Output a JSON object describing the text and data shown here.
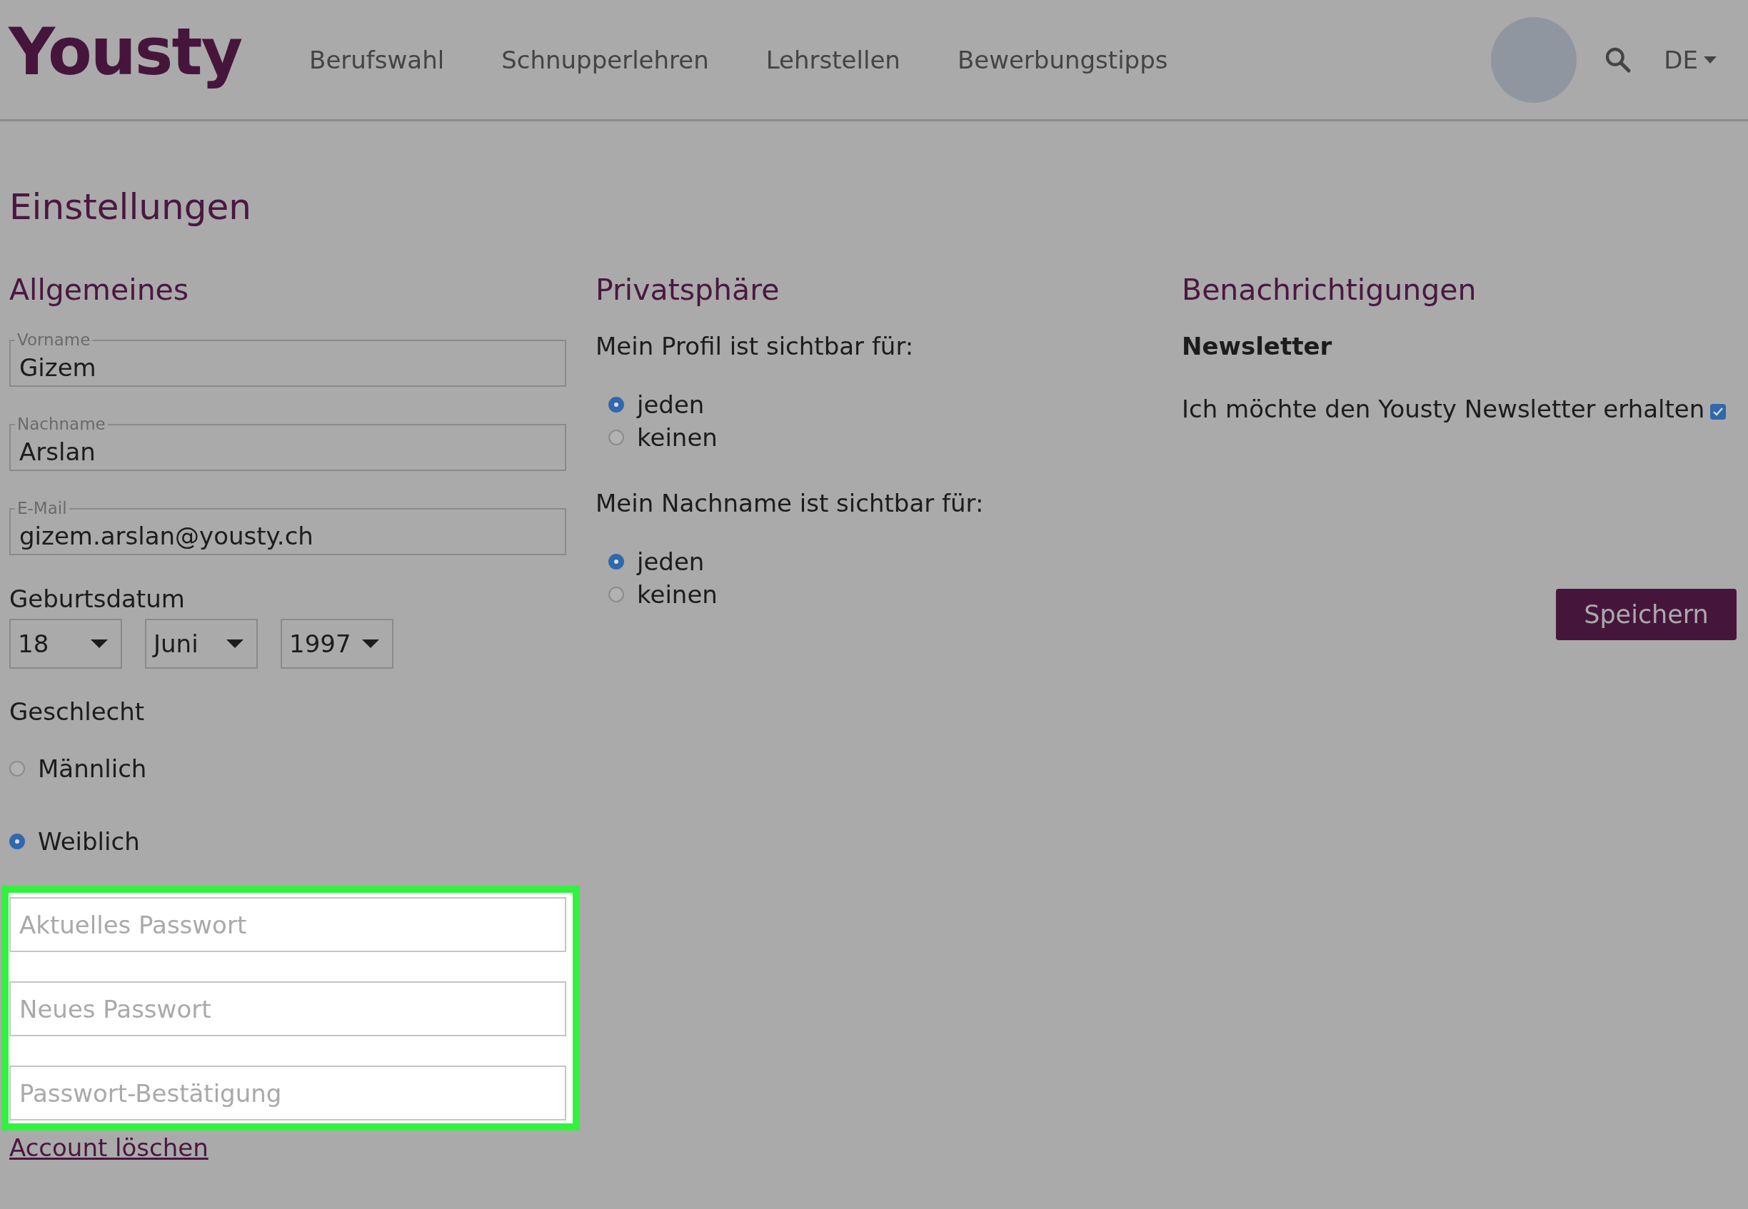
{
  "header": {
    "logo": "Yousty",
    "nav": [
      {
        "label": "Berufswahl"
      },
      {
        "label": "Schnupperlehren"
      },
      {
        "label": "Lehrstellen"
      },
      {
        "label": "Bewerbungstipps"
      }
    ],
    "language": "DE"
  },
  "page_title": "Einstellungen",
  "general": {
    "heading": "Allgemeines",
    "fields": [
      {
        "label": "Vorname",
        "value": "Gizem"
      },
      {
        "label": "Nachname",
        "value": "Arslan"
      },
      {
        "label": "E-Mail",
        "value": "gizem.arslan@yousty.ch"
      }
    ],
    "birthdate": {
      "label": "Geburtsdatum",
      "selects": [
        "18",
        "Juni",
        "1997"
      ]
    },
    "gender": {
      "label": "Geschlecht",
      "options": [
        {
          "label": "Männlich",
          "selected": false
        },
        {
          "label": "Weiblich",
          "selected": true
        }
      ]
    },
    "password": {
      "highlighted": true,
      "fields": [
        {
          "placeholder": "Aktuelles Passwort"
        },
        {
          "placeholder": "Neues Passwort"
        },
        {
          "placeholder": "Passwort-Bestätigung"
        }
      ]
    },
    "delete_link": "Account löschen"
  },
  "privacy": {
    "heading": "Privatsphäre",
    "groups": [
      {
        "question": "Mein Profil ist sichtbar für:",
        "options": [
          {
            "label": "jeden",
            "selected": true
          },
          {
            "label": "keinen",
            "selected": false
          }
        ]
      },
      {
        "question": "Mein Nachname ist sichtbar für:",
        "options": [
          {
            "label": "jeden",
            "selected": true
          },
          {
            "label": "keinen",
            "selected": false
          }
        ]
      }
    ]
  },
  "notifications": {
    "heading": "Benachrichtigungen",
    "subheading": "Newsletter",
    "newsletter": {
      "label": "Ich möchte den Yousty Newsletter erhalten",
      "checked": true
    }
  },
  "save_button": "Speichern"
}
